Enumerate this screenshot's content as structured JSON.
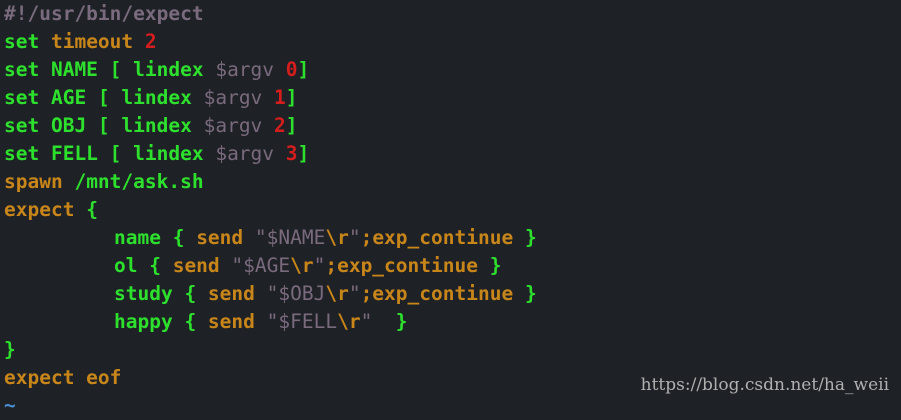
{
  "editor": {
    "lines": [
      {
        "tokens": [
          {
            "t": "#!/usr/bin/expect",
            "c": "c-comment"
          }
        ]
      },
      {
        "tokens": [
          {
            "t": "set ",
            "c": "c-green"
          },
          {
            "t": "timeout ",
            "c": "c-kw"
          },
          {
            "t": "2",
            "c": "c-num"
          }
        ]
      },
      {
        "tokens": [
          {
            "t": "set NAME [ lindex ",
            "c": "c-green"
          },
          {
            "t": "$argv ",
            "c": "c-var"
          },
          {
            "t": "0",
            "c": "c-num"
          },
          {
            "t": "]",
            "c": "c-green"
          }
        ]
      },
      {
        "tokens": [
          {
            "t": "set AGE [ lindex ",
            "c": "c-green"
          },
          {
            "t": "$argv ",
            "c": "c-var"
          },
          {
            "t": "1",
            "c": "c-num"
          },
          {
            "t": "]",
            "c": "c-green"
          }
        ]
      },
      {
        "tokens": [
          {
            "t": "set OBJ [ lindex ",
            "c": "c-green"
          },
          {
            "t": "$argv ",
            "c": "c-var"
          },
          {
            "t": "2",
            "c": "c-num"
          },
          {
            "t": "]",
            "c": "c-green"
          }
        ]
      },
      {
        "tokens": [
          {
            "t": "set FELL [ lindex ",
            "c": "c-green"
          },
          {
            "t": "$argv ",
            "c": "c-var"
          },
          {
            "t": "3",
            "c": "c-num"
          },
          {
            "t": "]",
            "c": "c-green"
          }
        ]
      },
      {
        "tokens": [
          {
            "t": "spawn ",
            "c": "c-kw"
          },
          {
            "t": "/mnt/ask.sh",
            "c": "c-green"
          }
        ]
      },
      {
        "tokens": [
          {
            "t": "expect ",
            "c": "c-kw"
          },
          {
            "t": "{",
            "c": "c-green"
          }
        ]
      },
      {
        "indent": true,
        "tokens": [
          {
            "t": "name { ",
            "c": "c-green"
          },
          {
            "t": "send ",
            "c": "c-kw"
          },
          {
            "t": "\"$NAME",
            "c": "c-str"
          },
          {
            "t": "\\r",
            "c": "c-esc"
          },
          {
            "t": "\"",
            "c": "c-str"
          },
          {
            "t": ";exp_continue ",
            "c": "c-kw"
          },
          {
            "t": "}",
            "c": "c-green"
          }
        ]
      },
      {
        "indent": true,
        "tokens": [
          {
            "t": "ol { ",
            "c": "c-green"
          },
          {
            "t": "send ",
            "c": "c-kw"
          },
          {
            "t": "\"$AGE",
            "c": "c-str"
          },
          {
            "t": "\\r",
            "c": "c-esc"
          },
          {
            "t": "\"",
            "c": "c-str"
          },
          {
            "t": ";exp_continue ",
            "c": "c-kw"
          },
          {
            "t": "}",
            "c": "c-green"
          }
        ]
      },
      {
        "indent": true,
        "tokens": [
          {
            "t": "study { ",
            "c": "c-green"
          },
          {
            "t": "send ",
            "c": "c-kw"
          },
          {
            "t": "\"$OBJ",
            "c": "c-str"
          },
          {
            "t": "\\r",
            "c": "c-esc"
          },
          {
            "t": "\"",
            "c": "c-str"
          },
          {
            "t": ";exp_continue ",
            "c": "c-kw"
          },
          {
            "t": "}",
            "c": "c-green"
          }
        ]
      },
      {
        "indent": true,
        "tokens": [
          {
            "t": "happy { ",
            "c": "c-green"
          },
          {
            "t": "send ",
            "c": "c-kw"
          },
          {
            "t": "\"$FELL",
            "c": "c-str"
          },
          {
            "t": "\\r",
            "c": "c-esc"
          },
          {
            "t": "\"",
            "c": "c-str"
          },
          {
            "t": "  }",
            "c": "c-green"
          }
        ]
      },
      {
        "tokens": [
          {
            "t": "}",
            "c": "c-green"
          }
        ]
      },
      {
        "tokens": [
          {
            "t": "expect eof",
            "c": "c-kw"
          }
        ]
      },
      {
        "tokens": [
          {
            "t": "~",
            "c": "c-tilde"
          }
        ]
      }
    ]
  },
  "watermark": "https://blog.csdn.net/ha_weii",
  "colors": {
    "background": "#1e2125",
    "keyword": "#c8861a",
    "identifier": "#2ee02e",
    "variable": "#7a6a7e",
    "number": "#d51d1d",
    "tilde": "#4b8fd6"
  }
}
